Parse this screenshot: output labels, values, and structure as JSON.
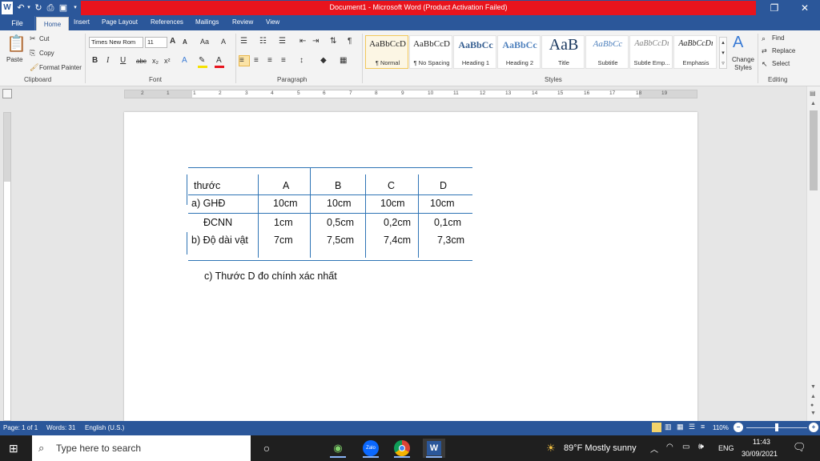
{
  "window": {
    "title": "Document1 - Microsoft Word (Product Activation Failed)",
    "minimize_icon": "restore-icon",
    "close_icon": "close-icon"
  },
  "tabs": [
    "File",
    "Home",
    "Insert",
    "Page Layout",
    "References",
    "Mailings",
    "Review",
    "View"
  ],
  "clipboard": {
    "paste": "Paste",
    "cut": "Cut",
    "copy": "Copy",
    "format_painter": "Format Painter",
    "label": "Clipboard"
  },
  "font": {
    "name": "Times New Rom",
    "size": "11",
    "label": "Font"
  },
  "paragraph": {
    "label": "Paragraph"
  },
  "styles": {
    "label": "Styles",
    "items": [
      {
        "sample": "AaBbCcD",
        "name": "¶ Normal"
      },
      {
        "sample": "AaBbCcD",
        "name": "¶ No Spacing"
      },
      {
        "sample": "AaBbCc",
        "name": "Heading 1"
      },
      {
        "sample": "AaBbCc",
        "name": "Heading 2"
      },
      {
        "sample": "AaB",
        "name": "Title"
      },
      {
        "sample": "AaBbCc",
        "name": "Subtitle"
      },
      {
        "sample": "AaBbCcDı",
        "name": "Subtle Emp..."
      },
      {
        "sample": "AaBbCcDı",
        "name": "Emphasis"
      }
    ],
    "change_styles": "Change Styles"
  },
  "editing": {
    "find": "Find",
    "replace": "Replace",
    "select": "Select",
    "label": "Editing"
  },
  "ruler": {
    "numbers": [
      "2",
      "1",
      "1",
      "2",
      "3",
      "4",
      "5",
      "6",
      "7",
      "8",
      "9",
      "10",
      "11",
      "12",
      "13",
      "14",
      "15",
      "16",
      "17",
      "18",
      "19"
    ]
  },
  "document": {
    "table": {
      "header": [
        "thước",
        "A",
        "B",
        "C",
        "D"
      ],
      "rows": [
        [
          "a) GHĐ",
          "10cm",
          "10cm",
          "10cm",
          "10cm"
        ],
        [
          "ĐCNN",
          "1cm",
          "0,5cm",
          "0,2cm",
          "0,1cm"
        ],
        [
          "b) Độ dài vật",
          "7cm",
          "7,5cm",
          "7,4cm",
          "7,3cm"
        ]
      ]
    },
    "note": "c) Thước D đo chính xác nhất"
  },
  "status": {
    "page": "Page: 1 of 1",
    "words": "Words: 31",
    "language": "English (U.S.)",
    "zoom": "110%"
  },
  "taskbar": {
    "search_placeholder": "Type here to search",
    "weather": "89°F  Mostly sunny",
    "lang": "ENG",
    "time": "11:43",
    "date": "30/09/2021"
  },
  "colors": {
    "word_blue": "#2b579a",
    "title_alert_red": "#e8141d",
    "table_border": "#2e74b5"
  }
}
